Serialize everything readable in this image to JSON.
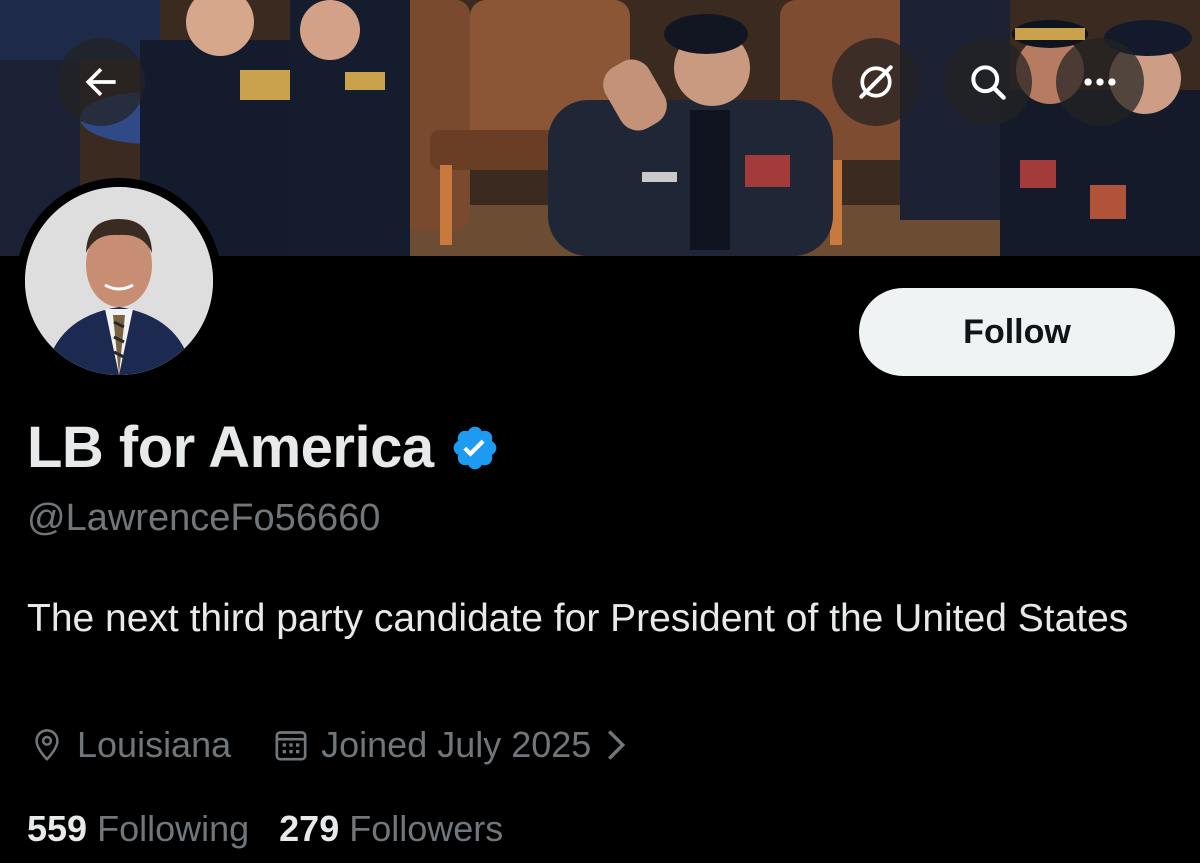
{
  "header": {
    "back_icon": "arrow-left-icon",
    "grok_icon": "grok-icon",
    "search_icon": "search-icon",
    "more_icon": "more-horizontal-icon"
  },
  "profile": {
    "display_name": "LB for America",
    "verified": true,
    "verified_color": "#1d9bf0",
    "handle": "@LawrenceFo56660",
    "bio": "The next third party candidate for President of the United States",
    "location": "Louisiana",
    "location_icon": "location-pin-icon",
    "joined": "Joined July 2025",
    "joined_icon": "calendar-icon",
    "follow_label": "Follow"
  },
  "stats": {
    "following_count": "559",
    "following_label": "Following",
    "followers_count": "279",
    "followers_label": "Followers"
  },
  "colors": {
    "background": "#000000",
    "text_primary": "#e7e9ea",
    "text_secondary": "#71767b",
    "follow_button_bg": "#eff3f4"
  }
}
